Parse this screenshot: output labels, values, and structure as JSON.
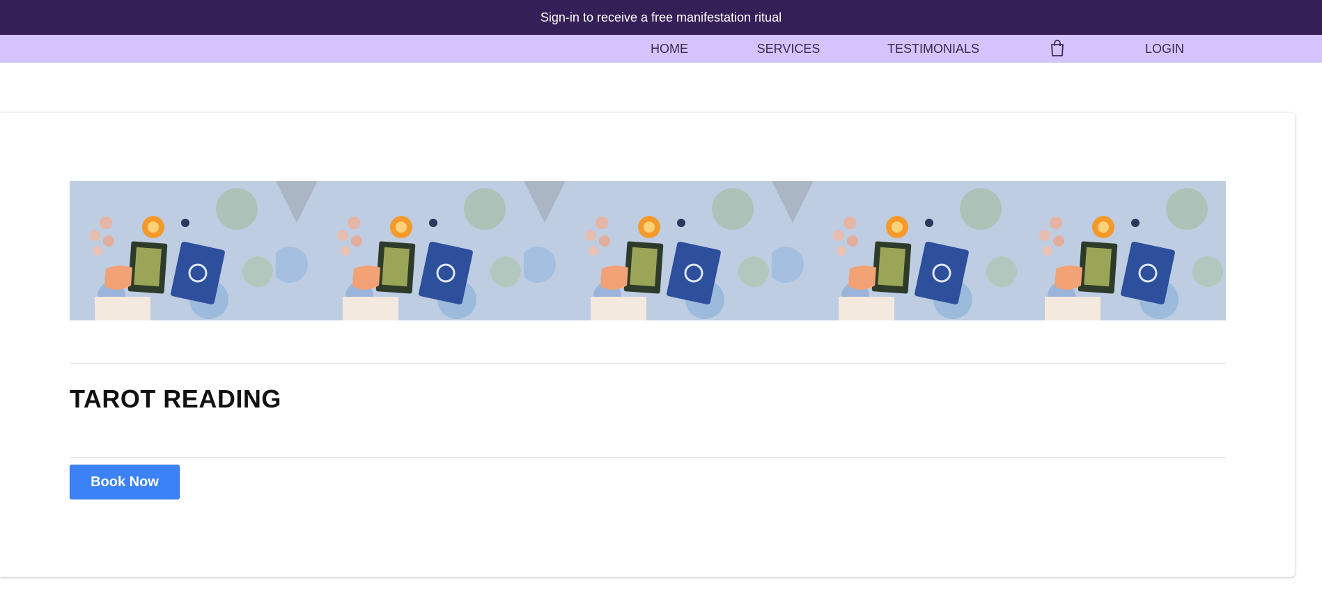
{
  "banner": {
    "text": "Sign-in to receive a free manifestation ritual"
  },
  "nav": {
    "home": "HOME",
    "services": "SERVICES",
    "testimonials": "TESTIMONIALS",
    "cart_icon": "shopping-bag-icon",
    "login": "LOGIN"
  },
  "service": {
    "title": "TAROT READING",
    "book_label": "Book Now",
    "gallery_image": "tarot-spread-photo",
    "gallery_count": 5
  },
  "colors": {
    "banner_bg": "#351f57",
    "nav_bg": "#d5c3fd",
    "button_bg": "#3b82f6"
  }
}
